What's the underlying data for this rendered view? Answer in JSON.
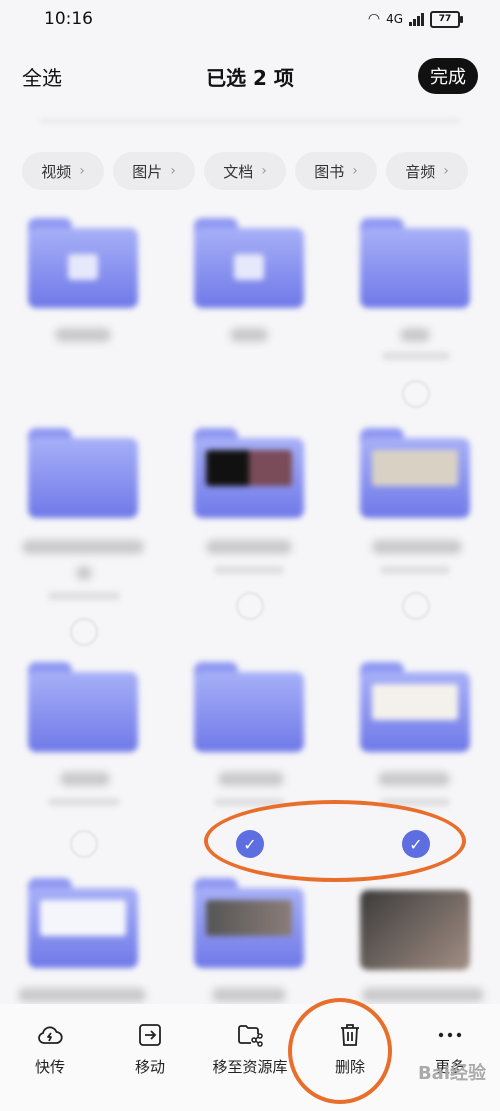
{
  "status_bar": {
    "time": "10:16",
    "network": "4G",
    "battery": "77"
  },
  "header": {
    "select_all": "全选",
    "title": "已选 2 项",
    "done": "完成"
  },
  "chips": [
    {
      "label": "视频"
    },
    {
      "label": "图片"
    },
    {
      "label": "文档"
    },
    {
      "label": "图书"
    },
    {
      "label": "音频"
    }
  ],
  "checkmark": "✓",
  "chevron": "›",
  "toolbar": {
    "items": [
      {
        "label": "快传",
        "icon": "cloud-share-icon"
      },
      {
        "label": "移动",
        "icon": "move-icon"
      },
      {
        "label": "移至资源库",
        "icon": "folder-share-icon"
      },
      {
        "label": "删除",
        "icon": "trash-icon"
      },
      {
        "label": "更多",
        "icon": "more-icon"
      }
    ]
  },
  "watermark": "Bai经验",
  "colors": {
    "accent": "#5d6ee0",
    "annotation": "#e86e2c",
    "folder": "#8f98f2"
  }
}
